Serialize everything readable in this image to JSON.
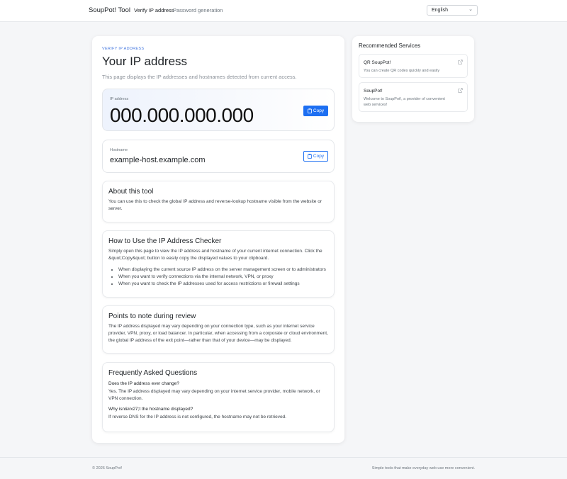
{
  "header": {
    "brand": "SoupPot! Tool",
    "nav": [
      {
        "label": "Verify IP address"
      },
      {
        "label": "Password generation"
      }
    ],
    "language": "English"
  },
  "main": {
    "eyebrow": "VERIFY IP ADDRESS",
    "title": "Your IP address",
    "lead": "This page displays the IP addresses and hostnames detected from current access.",
    "ip": {
      "label": "IP address",
      "value": "000.000.000.000",
      "copy_label": "Copy"
    },
    "hostname": {
      "label": "Hostname",
      "value": "example-host.example.com",
      "copy_label": "Copy"
    },
    "about": {
      "title": "About this tool",
      "text": "You can use this to check the global IP address and reverse-lookup hostname visible from the website or server."
    },
    "howto": {
      "title": "How to Use the IP Address Checker",
      "text": "Simply open this page to view the IP address and hostname of your current internet connection. Click the &quot;Copy&quot; button to easily copy the displayed values to your clipboard.",
      "items": [
        "When displaying the current source IP address on the server management screen or to administrators",
        "When you want to verify connections via the internal network, VPN, or proxy",
        "When you want to check the IP addresses used for access restrictions or firewall settings"
      ]
    },
    "notes": {
      "title": "Points to note during review",
      "text": "The IP address displayed may vary depending on your connection type, such as your internet service provider, VPN, proxy, or load balancer. In particular, when accessing from a corporate or cloud environment, the global IP address of the exit point—rather than that of your device—may be displayed."
    },
    "faq": {
      "title": "Frequently Asked Questions",
      "items": [
        {
          "q": "Does the IP address ever change?",
          "a": "Yes. The IP address displayed may vary depending on your internet service provider, mobile network, or VPN connection."
        },
        {
          "q": "Why isn&#x27;t the hostname displayed?",
          "a": "If reverse DNS for the IP address is not configured, the hostname may not be retrieved."
        }
      ]
    }
  },
  "sidebar": {
    "title": "Recommended Services",
    "items": [
      {
        "title": "QR SoupPot!",
        "desc": "You can create QR codes quickly and easily"
      },
      {
        "title": "SoupPot!",
        "desc": "Welcome to SoupPot!, a provider of convenient web services!"
      }
    ]
  },
  "footer": {
    "copyright": "© 2026 SoupPot!",
    "tagline": "Simple tools that make everyday web use more convenient."
  },
  "colors": {
    "accent": "#1d6ff2",
    "eyebrow": "#4a7be0",
    "background": "#f5f6f8"
  }
}
